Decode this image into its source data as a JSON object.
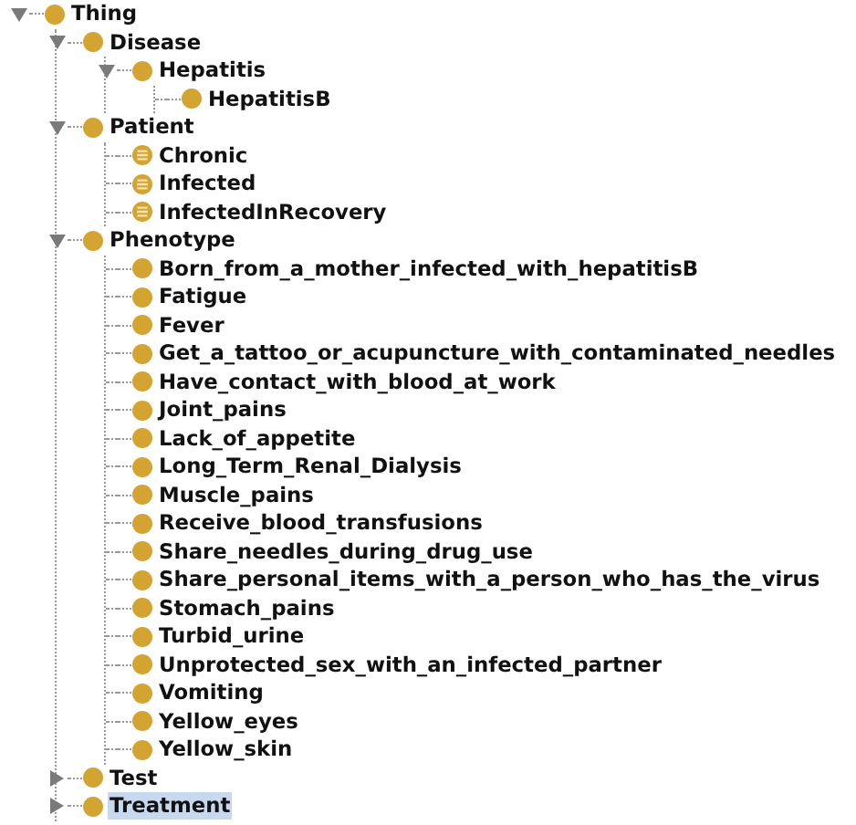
{
  "class_tree": [
    {
      "label": "Thing",
      "kind": "class",
      "expanded": true,
      "selected": false,
      "children": [
        {
          "label": "Disease",
          "kind": "class",
          "expanded": true,
          "selected": false,
          "children": [
            {
              "label": "Hepatitis",
              "kind": "class",
              "expanded": true,
              "selected": false,
              "children": [
                {
                  "label": "HepatitisB",
                  "kind": "class",
                  "selected": false
                }
              ]
            }
          ]
        },
        {
          "label": "Patient",
          "kind": "class",
          "expanded": true,
          "selected": false,
          "children": [
            {
              "label": "Chronic",
              "kind": "defined",
              "selected": false
            },
            {
              "label": "Infected",
              "kind": "defined",
              "selected": false
            },
            {
              "label": "InfectedInRecovery",
              "kind": "defined",
              "selected": false
            }
          ]
        },
        {
          "label": "Phenotype",
          "kind": "class",
          "expanded": true,
          "selected": false,
          "children": [
            {
              "label": "Born_from_a_mother_infected_with_hepatitisB",
              "kind": "class",
              "selected": false
            },
            {
              "label": "Fatigue",
              "kind": "class",
              "selected": false
            },
            {
              "label": "Fever",
              "kind": "class",
              "selected": false
            },
            {
              "label": "Get_a_tattoo_or_acupuncture_with_contaminated_needles",
              "kind": "class",
              "selected": false
            },
            {
              "label": "Have_contact_with_blood_at_work",
              "kind": "class",
              "selected": false
            },
            {
              "label": "Joint_pains",
              "kind": "class",
              "selected": false
            },
            {
              "label": "Lack_of_appetite",
              "kind": "class",
              "selected": false
            },
            {
              "label": "Long_Term_Renal_Dialysis",
              "kind": "class",
              "selected": false
            },
            {
              "label": "Muscle_pains",
              "kind": "class",
              "selected": false
            },
            {
              "label": "Receive_blood_transfusions",
              "kind": "class",
              "selected": false
            },
            {
              "label": "Share_needles_during_drug_use",
              "kind": "class",
              "selected": false
            },
            {
              "label": "Share_personal_items_with_a_person_who_has_the_virus",
              "kind": "class",
              "selected": false
            },
            {
              "label": "Stomach_pains",
              "kind": "class",
              "selected": false
            },
            {
              "label": "Turbid_urine",
              "kind": "class",
              "selected": false
            },
            {
              "label": "Unprotected_sex_with_an_infected_partner",
              "kind": "class",
              "selected": false
            },
            {
              "label": "Vomiting",
              "kind": "class",
              "selected": false
            },
            {
              "label": "Yellow_eyes",
              "kind": "class",
              "selected": false
            },
            {
              "label": "Yellow_skin",
              "kind": "class",
              "selected": false
            }
          ]
        },
        {
          "label": "Test",
          "kind": "class",
          "expanded": false,
          "selected": false
        },
        {
          "label": "Treatment",
          "kind": "class",
          "expanded": false,
          "selected": true
        }
      ]
    }
  ]
}
